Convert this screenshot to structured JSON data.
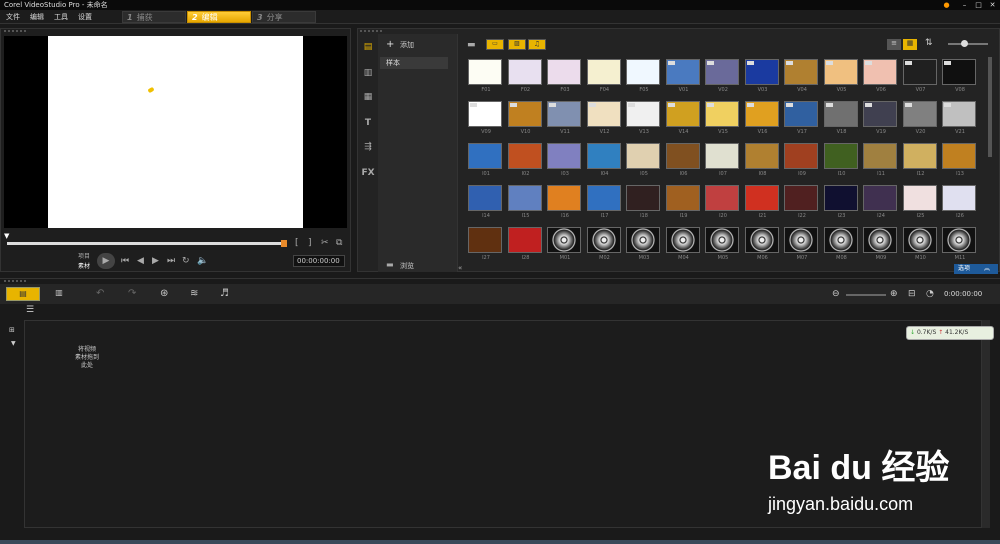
{
  "window": {
    "title": "Corel VideoStudio Pro - 未命名"
  },
  "menu": [
    "文件",
    "编辑",
    "工具",
    "设置"
  ],
  "steps": [
    {
      "num": "1",
      "label": "捕获"
    },
    {
      "num": "2",
      "label": "编辑"
    },
    {
      "num": "3",
      "label": "分享"
    }
  ],
  "player": {
    "mode_top": "项目",
    "mode_bottom": "素材",
    "timecode": "00:00:00:00"
  },
  "library": {
    "add_label": "添加",
    "folder_label": "样本",
    "browse_label": "浏览",
    "options_label": "选项"
  },
  "thumbnails": {
    "row1": [
      "F01",
      "F02",
      "F03",
      "F04",
      "F05",
      "V01",
      "V02",
      "V03",
      "V04",
      "V05",
      "V06",
      "V07",
      "V08"
    ],
    "row2": [
      "V09",
      "V10",
      "V11",
      "V12",
      "V13",
      "V14",
      "V15",
      "V16",
      "V17",
      "V18",
      "V19",
      "V20",
      "V21"
    ],
    "row3": [
      "I01",
      "I02",
      "I03",
      "I04",
      "I05",
      "I06",
      "I07",
      "I08",
      "I09",
      "I10",
      "I11",
      "I12",
      "I13"
    ],
    "row4": [
      "I14",
      "I15",
      "I16",
      "I17",
      "I18",
      "I19",
      "I20",
      "I21",
      "I22",
      "I23",
      "I24",
      "I25",
      "I26"
    ],
    "row5": [
      "I27",
      "I28",
      "M01",
      "M02",
      "M03",
      "M04",
      "M05",
      "M06",
      "M07",
      "M08",
      "M09",
      "M10",
      "M11"
    ]
  },
  "timeline": {
    "timecode": "0:00:00:00",
    "drop_hint": [
      "将视频",
      "素材拖到",
      "此处"
    ],
    "speed_down": "0.7K/S",
    "speed_up": "41.2K/S"
  },
  "watermark": {
    "logo": "Bai du 经验",
    "url": "jingyan.baidu.com"
  }
}
